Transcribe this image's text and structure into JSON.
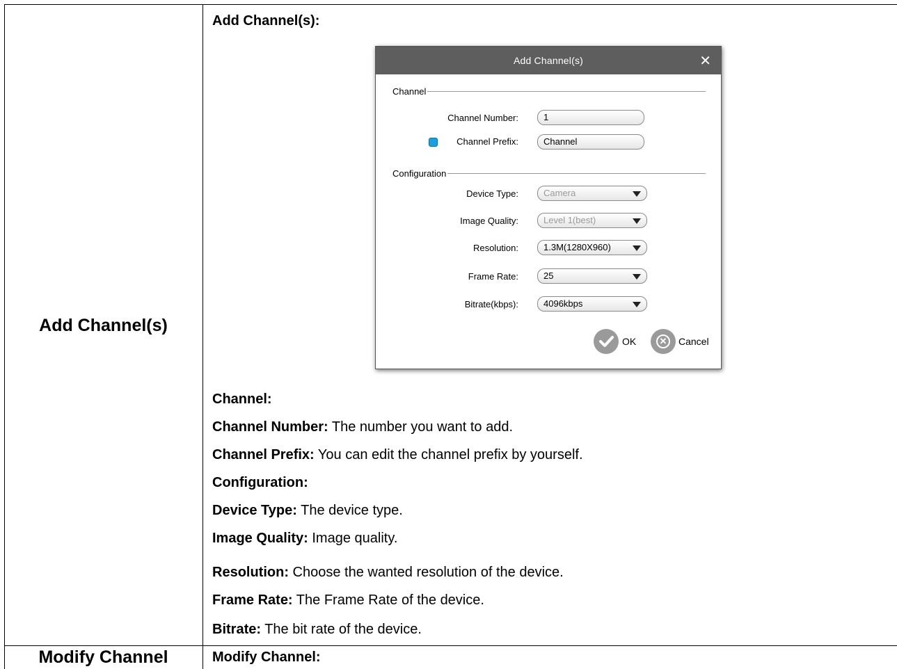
{
  "left_column": {
    "add_label": "Add Channel(s)",
    "modify_label": "Modify Channel"
  },
  "right_column": {
    "add_heading": "Add Channel(s):",
    "modify_heading": "Modify Channel:"
  },
  "dialog": {
    "title": "Add  Channel(s)",
    "close_glyph": "✕",
    "channel_group": "Channel",
    "configuration_group": "Configuration",
    "channel_number_label": "Channel Number:",
    "channel_number_value": "1",
    "channel_prefix_label": "Channel Prefix:",
    "channel_prefix_value": "Channel",
    "device_type_label": "Device Type:",
    "device_type_value": "Camera",
    "image_quality_label": "Image Quality:",
    "image_quality_value": "Level 1(best)",
    "resolution_label": "Resolution:",
    "resolution_value": "1.3M(1280X960)",
    "frame_rate_label": "Frame Rate:",
    "frame_rate_value": "25",
    "bitrate_label": "Bitrate(kbps):",
    "bitrate_value": "4096kbps",
    "ok_label": "OK",
    "cancel_label": "Cancel",
    "cancel_glyph": "✕",
    "check_color": "#1a9fe0"
  },
  "descriptions": {
    "channel_heading": "Channel:",
    "channel_number_term": "Channel Number:",
    "channel_number_text": " The number you want to add.",
    "channel_prefix_term": "Channel Prefix:",
    "channel_prefix_text": " You can edit the channel prefix by yourself.",
    "configuration_heading": "Configuration:",
    "device_type_term": "Device Type:",
    "device_type_text": " The device type.",
    "image_quality_term": "Image Quality:",
    "image_quality_text": " Image quality.",
    "resolution_term": "Resolution:",
    "resolution_text": " Choose the wanted resolution of the device.",
    "frame_rate_term": "Frame Rate:",
    "frame_rate_text": " The Frame Rate of the device.",
    "bitrate_term": "Bitrate:",
    "bitrate_text": " The bit rate of the device."
  }
}
